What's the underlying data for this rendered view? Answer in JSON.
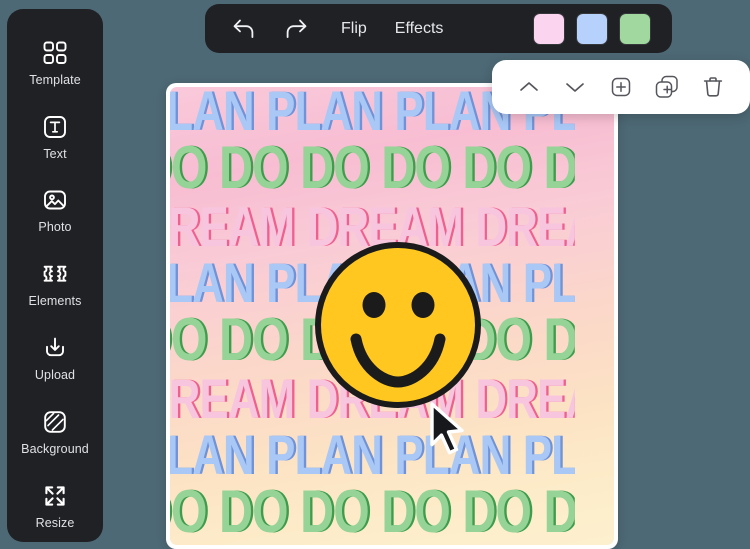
{
  "app": {
    "background_color": "#4d6975",
    "panel_color": "#202125"
  },
  "sidebar": {
    "items": [
      {
        "label": "Template",
        "icon": "grid-icon"
      },
      {
        "label": "Text",
        "icon": "text-icon"
      },
      {
        "label": "Photo",
        "icon": "photo-icon"
      },
      {
        "label": "Elements",
        "icon": "elements-icon"
      },
      {
        "label": "Upload",
        "icon": "upload-icon"
      },
      {
        "label": "Background",
        "icon": "background-icon"
      },
      {
        "label": "Resize",
        "icon": "resize-icon"
      }
    ]
  },
  "toolbar": {
    "undo_icon": "undo-icon",
    "redo_icon": "redo-icon",
    "flip_label": "Flip",
    "effects_label": "Effects",
    "swatches": [
      {
        "name": "pink",
        "color": "#fbd4f0"
      },
      {
        "name": "blue",
        "color": "#b6d1fb"
      },
      {
        "name": "green",
        "color": "#a0d8a0"
      }
    ]
  },
  "context_toolbar": {
    "items": [
      {
        "name": "bring-forward",
        "icon": "chevron-up-icon"
      },
      {
        "name": "send-backward",
        "icon": "chevron-down-icon"
      },
      {
        "name": "add",
        "icon": "plus-square-icon"
      },
      {
        "name": "duplicate",
        "icon": "duplicate-icon"
      },
      {
        "name": "delete",
        "icon": "trash-icon"
      }
    ]
  },
  "canvas": {
    "words": {
      "plan": "PLAN",
      "do": "DO",
      "dream": "DREAM"
    },
    "rows": [
      {
        "word": "PLAN",
        "style": "s-plan"
      },
      {
        "word": "DO",
        "style": "s-do"
      },
      {
        "word": "DREAM",
        "style": "s-dream"
      },
      {
        "word": "PLAN",
        "style": "s-plan"
      },
      {
        "word": "DO",
        "style": "s-do"
      },
      {
        "word": "DREAM",
        "style": "s-dream"
      },
      {
        "word": "PLAN",
        "style": "s-plan"
      },
      {
        "word": "DO",
        "style": "s-do"
      }
    ],
    "colors": {
      "plan_fill": "#a9c8f6",
      "plan_shadow": "#6f92d8",
      "do_fill": "#95d397",
      "do_shadow": "#3e9c4c",
      "dream_fill": "#f8c5de",
      "dream_shadow": "#f0608f",
      "smiley_fill": "#ffc71f",
      "smiley_stroke": "#1b1b1b"
    },
    "sticker": {
      "name": "smiley-face",
      "label": "Smiley face sticker"
    },
    "cursor": {
      "name": "mouse-cursor"
    }
  }
}
